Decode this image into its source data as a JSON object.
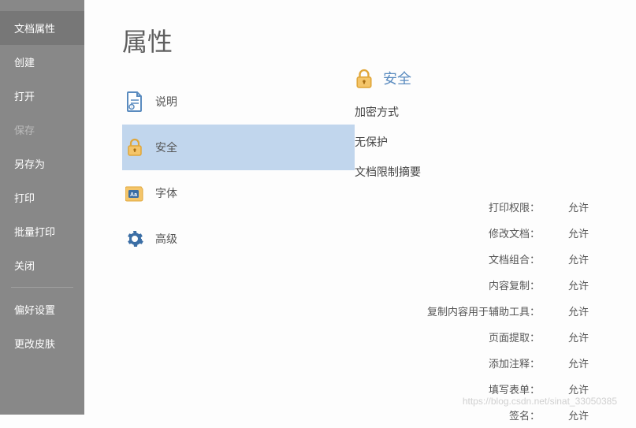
{
  "sidebar": {
    "items": [
      {
        "label": "文档属性",
        "state": "active"
      },
      {
        "label": "创建",
        "state": "normal"
      },
      {
        "label": "打开",
        "state": "normal"
      },
      {
        "label": "保存",
        "state": "disabled"
      },
      {
        "label": "另存为",
        "state": "normal"
      },
      {
        "label": "打印",
        "state": "normal"
      },
      {
        "label": "批量打印",
        "state": "normal"
      },
      {
        "label": "关闭",
        "state": "normal"
      },
      {
        "label": "偏好设置",
        "state": "normal"
      },
      {
        "label": "更改皮肤",
        "state": "normal"
      }
    ]
  },
  "main": {
    "title": "属性",
    "categories": [
      {
        "icon": "doc-info-icon",
        "label": "说明"
      },
      {
        "icon": "lock-icon",
        "label": "安全"
      },
      {
        "icon": "font-icon",
        "label": "字体"
      },
      {
        "icon": "gear-icon",
        "label": "高级"
      }
    ]
  },
  "security": {
    "title": "安全",
    "encryption_label": "加密方式",
    "encryption_value": "无保护",
    "restrictions_label": "文档限制摘要",
    "permissions": [
      {
        "label": "打印权限：",
        "value": "允许"
      },
      {
        "label": "修改文档：",
        "value": "允许"
      },
      {
        "label": "文档组合：",
        "value": "允许"
      },
      {
        "label": "内容复制：",
        "value": "允许"
      },
      {
        "label": "复制内容用于辅助工具：",
        "value": "允许"
      },
      {
        "label": "页面提取：",
        "value": "允许"
      },
      {
        "label": "添加注释：",
        "value": "允许"
      },
      {
        "label": "填写表单：",
        "value": "允许"
      },
      {
        "label": "签名：",
        "value": "允许"
      }
    ]
  },
  "watermark": "https://blog.csdn.net/sinat_33050385"
}
